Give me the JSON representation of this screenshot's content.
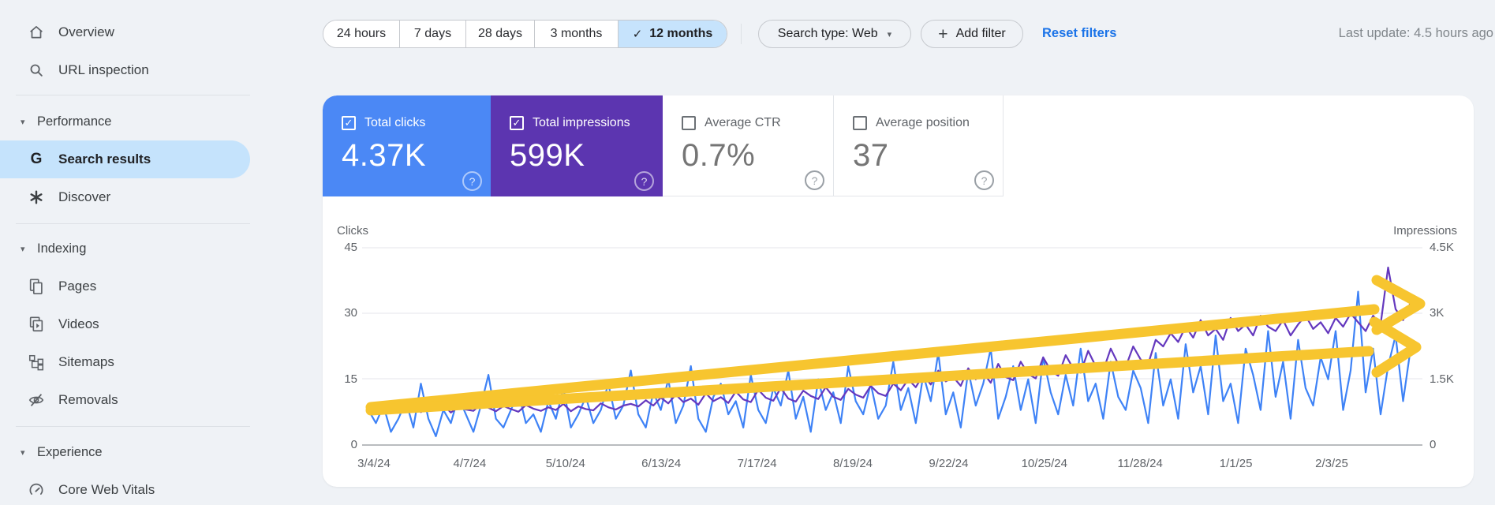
{
  "sidebar": {
    "top_items": [
      {
        "label": "Overview",
        "icon": "home-icon"
      },
      {
        "label": "URL inspection",
        "icon": "search-icon"
      }
    ],
    "sections": [
      {
        "header": "Performance",
        "items": [
          {
            "label": "Search results",
            "icon": "google-g-icon",
            "selected": true
          },
          {
            "label": "Discover",
            "icon": "asterisk-icon",
            "selected": false
          }
        ]
      },
      {
        "header": "Indexing",
        "items": [
          {
            "label": "Pages",
            "icon": "pages-icon",
            "selected": false
          },
          {
            "label": "Videos",
            "icon": "videos-icon",
            "selected": false
          },
          {
            "label": "Sitemaps",
            "icon": "sitemap-icon",
            "selected": false
          },
          {
            "label": "Removals",
            "icon": "eye-off-icon",
            "selected": false
          }
        ]
      },
      {
        "header": "Experience",
        "items": [
          {
            "label": "Core Web Vitals",
            "icon": "gauge-icon",
            "selected": false
          }
        ]
      }
    ]
  },
  "filters": {
    "date_ranges": [
      "24 hours",
      "7 days",
      "28 days",
      "3 months",
      "12 months"
    ],
    "selected_range": "12 months",
    "checkmark": "✓",
    "search_type_label": "Search type: Web",
    "add_filter_label": "Add filter",
    "reset_label": "Reset filters",
    "last_update": "Last update: 4.5 hours ago"
  },
  "metrics": {
    "cards": [
      {
        "label": "Total clicks",
        "value": "4.37K",
        "checked": true,
        "color": "#4B88F5"
      },
      {
        "label": "Total impressions",
        "value": "599K",
        "checked": true,
        "color": "#5C35B0"
      },
      {
        "label": "Average CTR",
        "value": "0.7%",
        "checked": false,
        "color": "#FFFFFF"
      },
      {
        "label": "Average position",
        "value": "37",
        "checked": false,
        "color": "#FFFFFF"
      }
    ],
    "help_glyph": "?"
  },
  "chart_data": {
    "type": "line",
    "x_tick_labels": [
      "3/4/24",
      "4/7/24",
      "5/10/24",
      "6/13/24",
      "7/17/24",
      "8/19/24",
      "9/22/24",
      "10/25/24",
      "11/28/24",
      "1/1/25",
      "2/3/25"
    ],
    "y_axis_left": {
      "label": "Clicks",
      "max": 45,
      "tick_values": [
        45,
        30,
        15,
        0
      ],
      "tick_labels": [
        "45",
        "30",
        "15",
        "0"
      ]
    },
    "y_axis_right": {
      "label": "Impressions",
      "max": 4500,
      "tick_values": [
        4500,
        3000,
        1500,
        0
      ],
      "tick_labels": [
        "4.5K",
        "3K",
        "1.5K",
        "0"
      ]
    },
    "grid": "horizontal",
    "legend_position": "none",
    "series": [
      {
        "name": "Total clicks",
        "axis": "left",
        "color": "#3E82F6",
        "values": [
          8,
          5,
          9,
          3,
          6,
          10,
          4,
          14,
          6,
          2,
          8,
          5,
          11,
          7,
          3,
          9,
          16,
          6,
          4,
          8,
          12,
          5,
          7,
          3,
          10,
          6,
          13,
          4,
          7,
          11,
          5,
          8,
          14,
          6,
          9,
          17,
          7,
          4,
          12,
          8,
          15,
          5,
          9,
          18,
          6,
          3,
          11,
          14,
          7,
          10,
          4,
          16,
          8,
          5,
          13,
          9,
          17,
          6,
          11,
          3,
          15,
          8,
          12,
          5,
          18,
          10,
          7,
          14,
          6,
          9,
          19,
          8,
          13,
          5,
          16,
          10,
          21,
          7,
          12,
          4,
          17,
          9,
          14,
          22,
          6,
          11,
          18,
          8,
          15,
          5,
          20,
          12,
          7,
          16,
          9,
          22,
          10,
          14,
          6,
          19,
          11,
          8,
          17,
          13,
          5,
          21,
          9,
          15,
          6,
          23,
          12,
          18,
          7,
          25,
          10,
          14,
          5,
          22,
          16,
          8,
          26,
          11,
          19,
          6,
          24,
          13,
          9,
          20,
          15,
          26,
          8,
          17,
          35,
          12,
          22,
          7,
          18,
          25,
          10,
          22
        ]
      },
      {
        "name": "Total impressions",
        "axis": "right",
        "color": "#6438BE",
        "values": [
          820,
          760,
          880,
          720,
          840,
          790,
          900,
          750,
          860,
          800,
          920,
          740,
          870,
          810,
          780,
          930,
          850,
          770,
          890,
          820,
          760,
          910,
          830,
          780,
          860,
          800,
          940,
          770,
          880,
          820,
          790,
          950,
          860,
          810,
          900,
          940,
          880,
          1020,
          900,
          1080,
          950,
          1150,
          980,
          1060,
          920,
          1180,
          1000,
          1090,
          960,
          1220,
          1040,
          980,
          1260,
          1080,
          1010,
          1300,
          1060,
          990,
          1240,
          1120,
          1050,
          1320,
          1100,
          1030,
          1280,
          1150,
          1080,
          1350,
          1180,
          1120,
          1400,
          1250,
          1500,
          1320,
          1600,
          1380,
          1700,
          1450,
          1550,
          1350,
          1750,
          1500,
          1650,
          1420,
          1850,
          1550,
          1480,
          1900,
          1620,
          1520,
          2000,
          1700,
          1580,
          2050,
          1750,
          1650,
          2150,
          1800,
          1700,
          2200,
          1850,
          1780,
          2250,
          1950,
          1850,
          2400,
          2250,
          2550,
          2350,
          2700,
          2450,
          2850,
          2500,
          2650,
          2400,
          2900,
          2600,
          2750,
          2500,
          2950,
          2700,
          2600,
          2850,
          2500,
          2750,
          2950,
          2650,
          2800,
          2550,
          2900,
          2700,
          3000,
          2800,
          2600,
          2950,
          2750,
          4050,
          3100,
          2850,
          3250
        ]
      }
    ],
    "annotations": [
      {
        "type": "arrow",
        "color": "#F7C52F",
        "description": "hand-drawn upward trend arrow, upper"
      },
      {
        "type": "arrow",
        "color": "#F7C52F",
        "description": "hand-drawn upward trend arrow, lower"
      }
    ]
  }
}
